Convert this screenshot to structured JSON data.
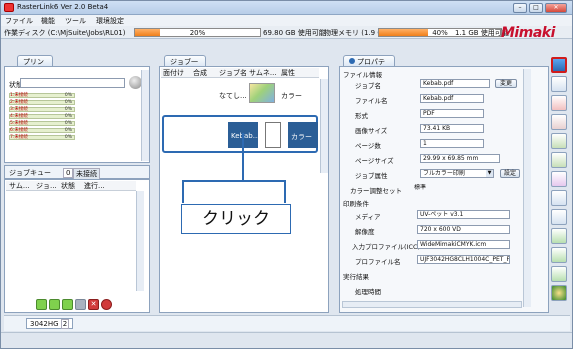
{
  "window": {
    "title": "RasterLink6 Ver 2.0 Beta4"
  },
  "menu": [
    "ファイル",
    "機能",
    "ツール",
    "環境設定"
  ],
  "status": {
    "disk_label": "作業ディスク (C:\\MjSuite\\Jobs\\RL01)",
    "disk_percent": "20%",
    "disk_fill": 0.2,
    "disk_free": "69.80 GB 使用可能",
    "mem_label": "物理メモリ (1.9 GB)",
    "mem_percent": "40%",
    "mem_fill": 0.4,
    "mem_free": "1.1 GB 使用可能"
  },
  "logo": "Mimaki",
  "printer": {
    "tab": "プリンタ",
    "state_label": "状態",
    "rows": [
      {
        "name": "1:未接続",
        "pct": "0%"
      },
      {
        "name": "2:未接続",
        "pct": "0%"
      },
      {
        "name": "3:未接続",
        "pct": "0%"
      },
      {
        "name": "4:未接続",
        "pct": "0%"
      },
      {
        "name": "5:未接続",
        "pct": "0%"
      },
      {
        "name": "6:未接続",
        "pct": "0%"
      },
      {
        "name": "7:未接続",
        "pct": "0%"
      }
    ]
  },
  "queue": {
    "tab_queue": "ジョブキュー",
    "tab_count": "0",
    "tab_done": "未接続",
    "cols": [
      "サム...",
      "ジョ...",
      "状態",
      "進行..."
    ]
  },
  "joblist": {
    "tab": "ジョブ一覧",
    "cols": [
      "面付け",
      "合成",
      "ジョブ名",
      "サムネ...",
      "属性"
    ],
    "rows": [
      {
        "name": "なてし...",
        "attr": "カラー"
      },
      {
        "name": "Kebab...",
        "attr": "カラー"
      }
    ]
  },
  "callout": "クリック",
  "props": {
    "tab": "プロパティ",
    "section_file": "ファイル情報",
    "job_name_label": "ジョブ名",
    "job_name": "Kebab.pdf",
    "change_btn": "変更",
    "file_name_label": "ファイル名",
    "file_name": "Kebab.pdf",
    "format_label": "形式",
    "format": "PDF",
    "image_size_label": "画像サイズ",
    "image_size": "73.41 KB",
    "pages_label": "ページ数",
    "pages": "1",
    "page_size_label": "ページサイズ",
    "page_size": "29.99 x 69.85 mm",
    "job_attr_label": "ジョブ属性",
    "job_attr": "フルカラー印刷",
    "settings_btn": "設定",
    "color_set_label": "カラー調整セット",
    "color_set": "標準",
    "section_print": "印刷条件",
    "media_label": "メディア",
    "media": "UV-ペット v3.1",
    "resolution_label": "解像度",
    "resolution": "720 x 600 VD",
    "input_profile_label": "入力プロファイル(ICC)",
    "input_profile": "WideMimakiCMYK.icm",
    "profile_label": "プロファイル名",
    "profile": "UJF3042HG8CLH1004C_PET_F1",
    "section_result": "実行結果",
    "process_time_label": "処理時間"
  },
  "bottom_tab": "3042HG",
  "bottom_tab_num": "2"
}
